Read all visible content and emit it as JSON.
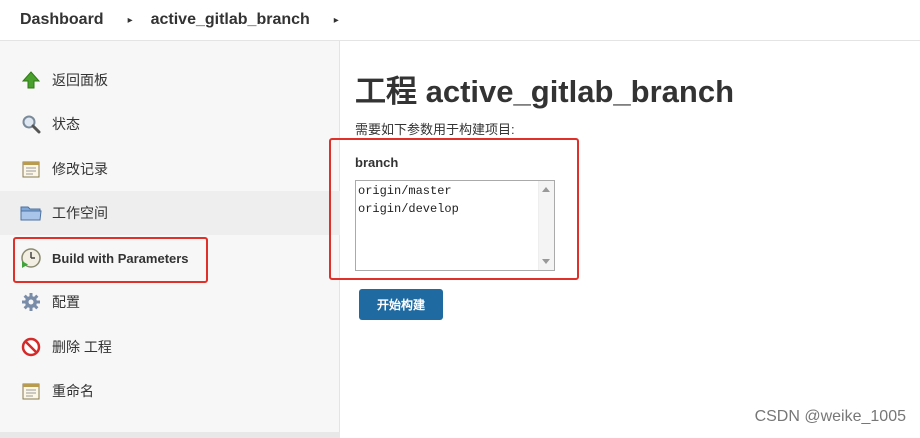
{
  "breadcrumb": {
    "items": [
      "Dashboard",
      "active_gitlab_branch"
    ],
    "sep": "▸"
  },
  "sidebar": {
    "items": [
      {
        "label": "返回面板",
        "icon": "up-arrow-icon"
      },
      {
        "label": "状态",
        "icon": "magnifier-icon"
      },
      {
        "label": "修改记录",
        "icon": "notepad-icon"
      },
      {
        "label": "工作空间",
        "icon": "folder-icon"
      },
      {
        "label": "Build with Parameters",
        "icon": "clock-play-icon"
      },
      {
        "label": "配置",
        "icon": "gear-icon"
      },
      {
        "label": "删除 工程",
        "icon": "no-entry-icon"
      },
      {
        "label": "重命名",
        "icon": "notepad-icon"
      }
    ]
  },
  "main": {
    "title": "工程 active_gitlab_branch",
    "description": "需要如下参数用于构建项目:",
    "parameter": {
      "name": "branch",
      "options": [
        "origin/master",
        "origin/develop"
      ]
    },
    "build_button": "开始构建"
  },
  "watermark": "CSDN @weike_1005",
  "colors": {
    "highlight_box": "#e0302a",
    "build_button": "#1e6aa1"
  }
}
